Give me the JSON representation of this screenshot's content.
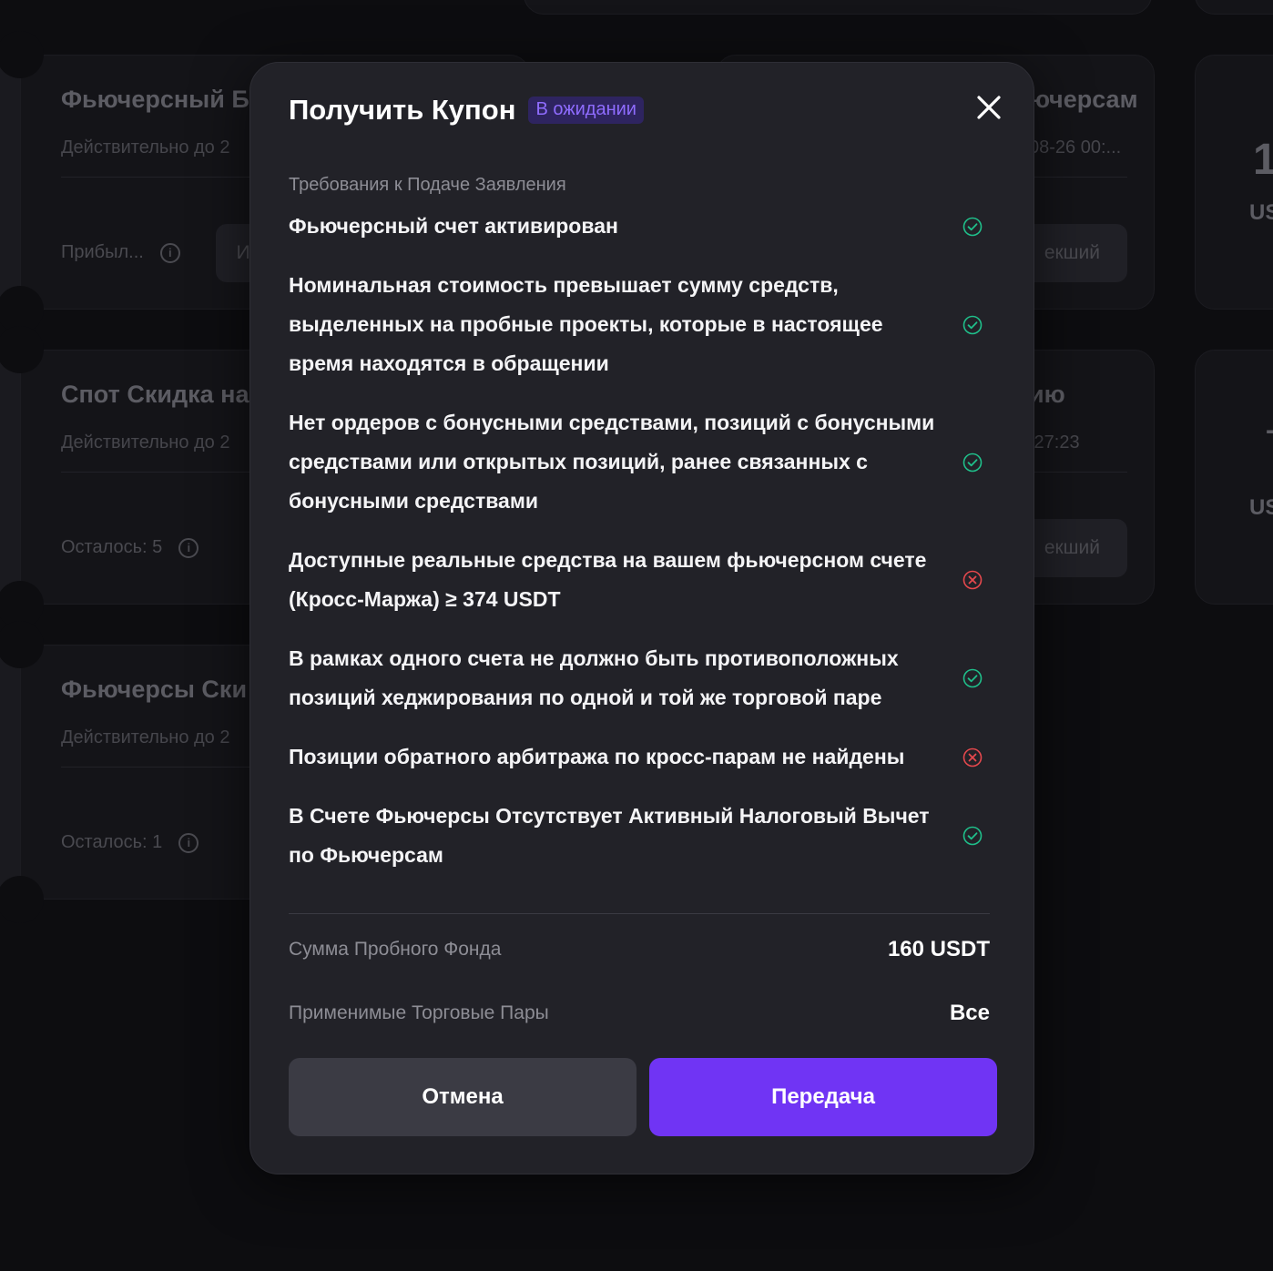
{
  "background": {
    "cards_left": [
      {
        "title": "Фьючерсный Б",
        "subtitle": "Действительно до 2",
        "meta": "Прибыл...",
        "button": "И"
      },
      {
        "title": "Спот Скидка на",
        "subtitle": "Действительно до 2",
        "meta": "Осталось: 5"
      },
      {
        "title": "Фьючерсы Ски",
        "subtitle": "Действительно до 2",
        "meta": "Осталось: 1"
      }
    ],
    "cards_right": [
      {
        "title": "ючерсам",
        "subtitle": "08-26 00:...",
        "button": "екший"
      },
      {
        "title": "ию",
        "subtitle": ":27:23",
        "button": "екший"
      }
    ],
    "far_right": [
      {
        "big": "1",
        "small": "US"
      },
      {
        "big": "-",
        "small": "US"
      }
    ]
  },
  "modal": {
    "title": "Получить Купон",
    "status": "В ожидании",
    "close_icon": "close-icon",
    "section_label": "Требования к Подаче Заявления",
    "requirements": [
      {
        "text": "Фьючерсный счет активирован",
        "status": "ok"
      },
      {
        "text": "Номинальная стоимость превышает сумму средств, выделенных на пробные проекты, которые в настоящее время находятся в обращении",
        "status": "ok"
      },
      {
        "text": "Нет ордеров с бонусными средствами, позиций с бонусными средствами или открытых позиций, ранее связанных с бонусными средствами",
        "status": "ok"
      },
      {
        "text": "Доступные реальные средства на вашем фьючерсном счете (Кросс-Маржа) ≥ 374 USDT",
        "status": "fail"
      },
      {
        "text": "В рамках одного счета не должно быть противоположных позиций хеджирования по одной и той же торговой паре",
        "status": "ok"
      },
      {
        "text": "Позиции обратного арбитража по кросс-парам не найдены",
        "status": "fail"
      },
      {
        "text": "В Счете Фьючерсы Отсутствует Активный Налоговый Вычет по Фьючерсам",
        "status": "ok"
      }
    ],
    "summary": [
      {
        "label": "Сумма Пробного Фонда",
        "value": "160 USDT"
      },
      {
        "label": "Применимые Торговые Пары",
        "value": "Все"
      }
    ],
    "cancel_label": "Отмена",
    "submit_label": "Передача"
  },
  "colors": {
    "ok": "#1fbf8a",
    "fail": "#e5484d",
    "accent": "#7034f4",
    "badge_text": "#8f6cff"
  }
}
